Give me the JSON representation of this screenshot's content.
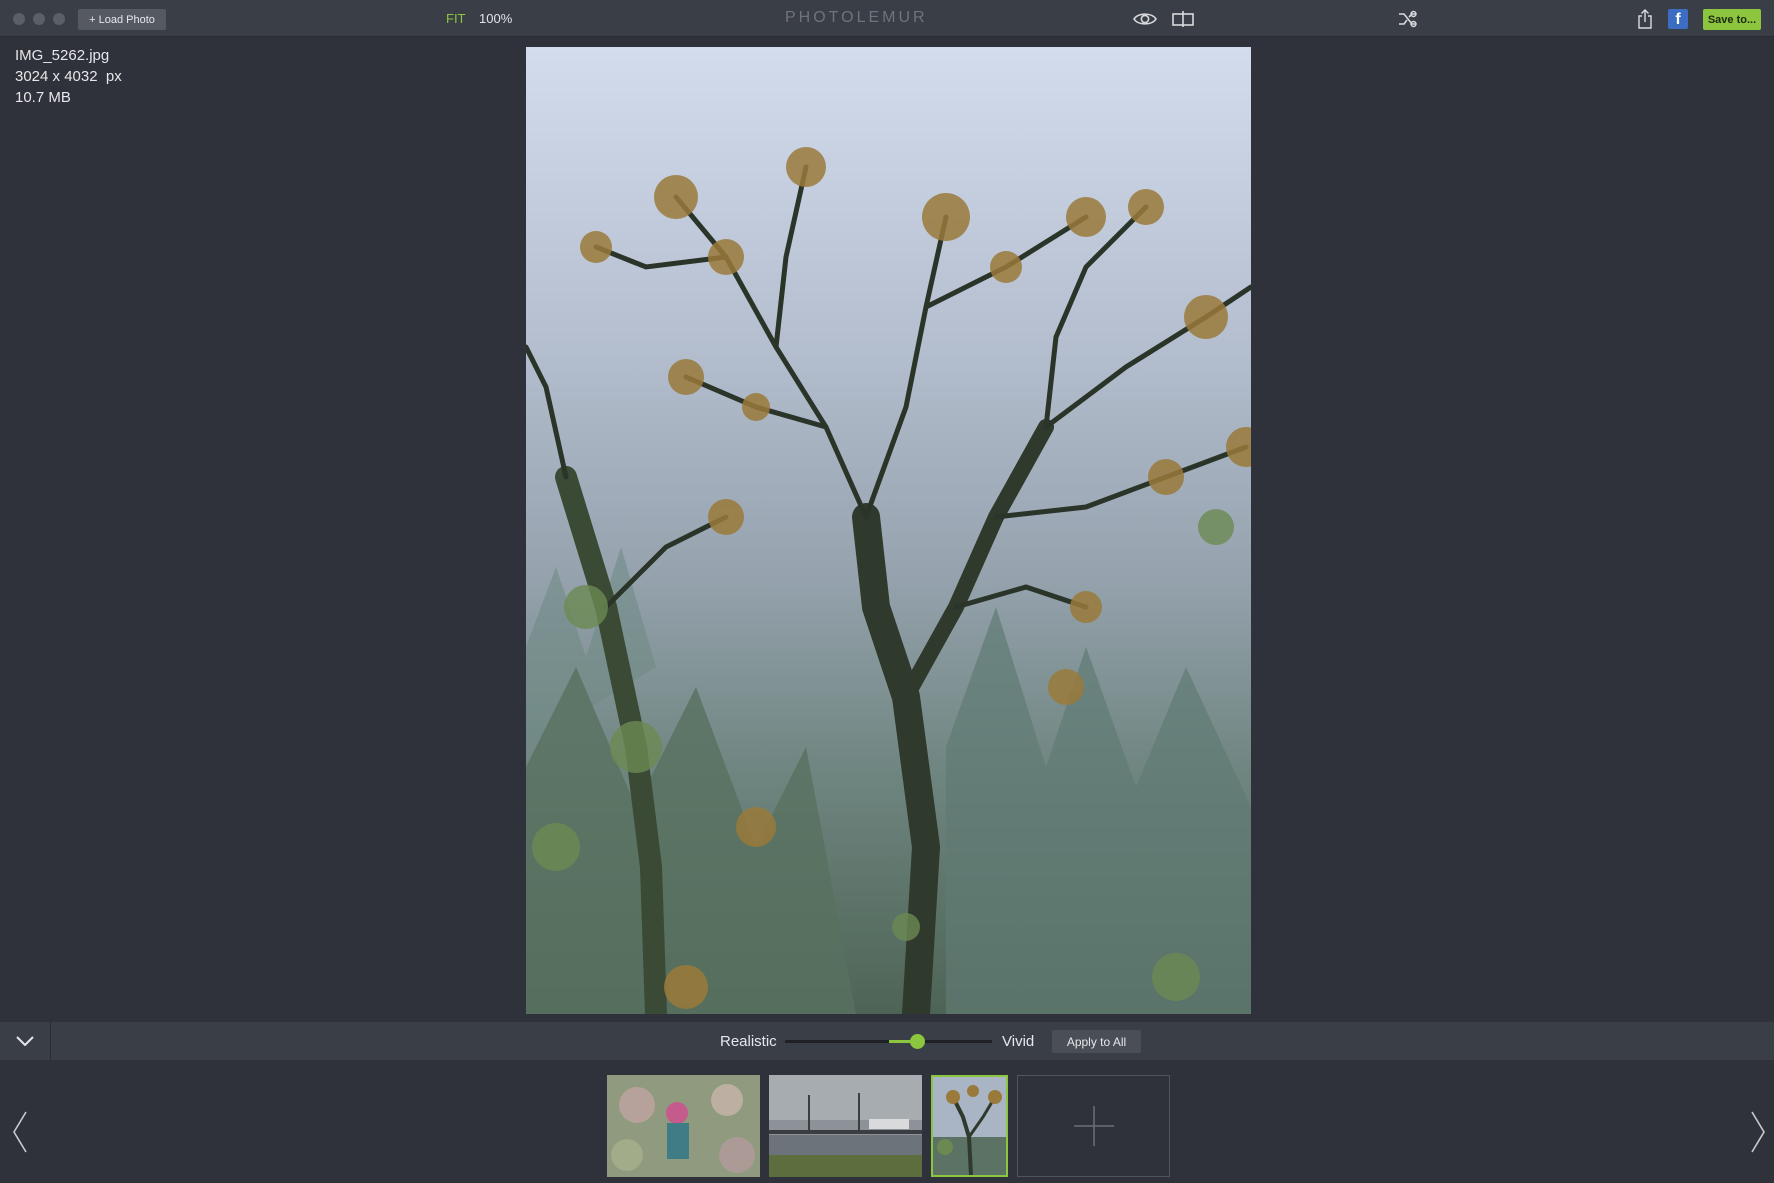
{
  "toolbar": {
    "load_photo_label": "+ Load Photo",
    "fit_label": "FIT",
    "zoom_label": "100%",
    "app_title": "PHOTOLEMUR",
    "save_label": "Save to...",
    "facebook_letter": "f",
    "icons": [
      "eye-icon",
      "compare-split-icon",
      "shuffle-icon",
      "share-icon",
      "facebook-icon"
    ]
  },
  "file_info": {
    "filename": "IMG_5262.jpg",
    "dimensions": "3024 x 4032  px",
    "size": "10.7 MB"
  },
  "slider": {
    "left_label": "Realistic",
    "right_label": "Vivid",
    "apply_label": "Apply to All",
    "level": 0.64
  },
  "filmstrip": {
    "thumbnails": [
      "flowers-portrait",
      "bridge-river",
      "misty-tree"
    ],
    "selected_index": 2
  },
  "colors": {
    "accent": "#8cc63f",
    "background": "#2f323a",
    "toolbar": "#3a3e47"
  }
}
